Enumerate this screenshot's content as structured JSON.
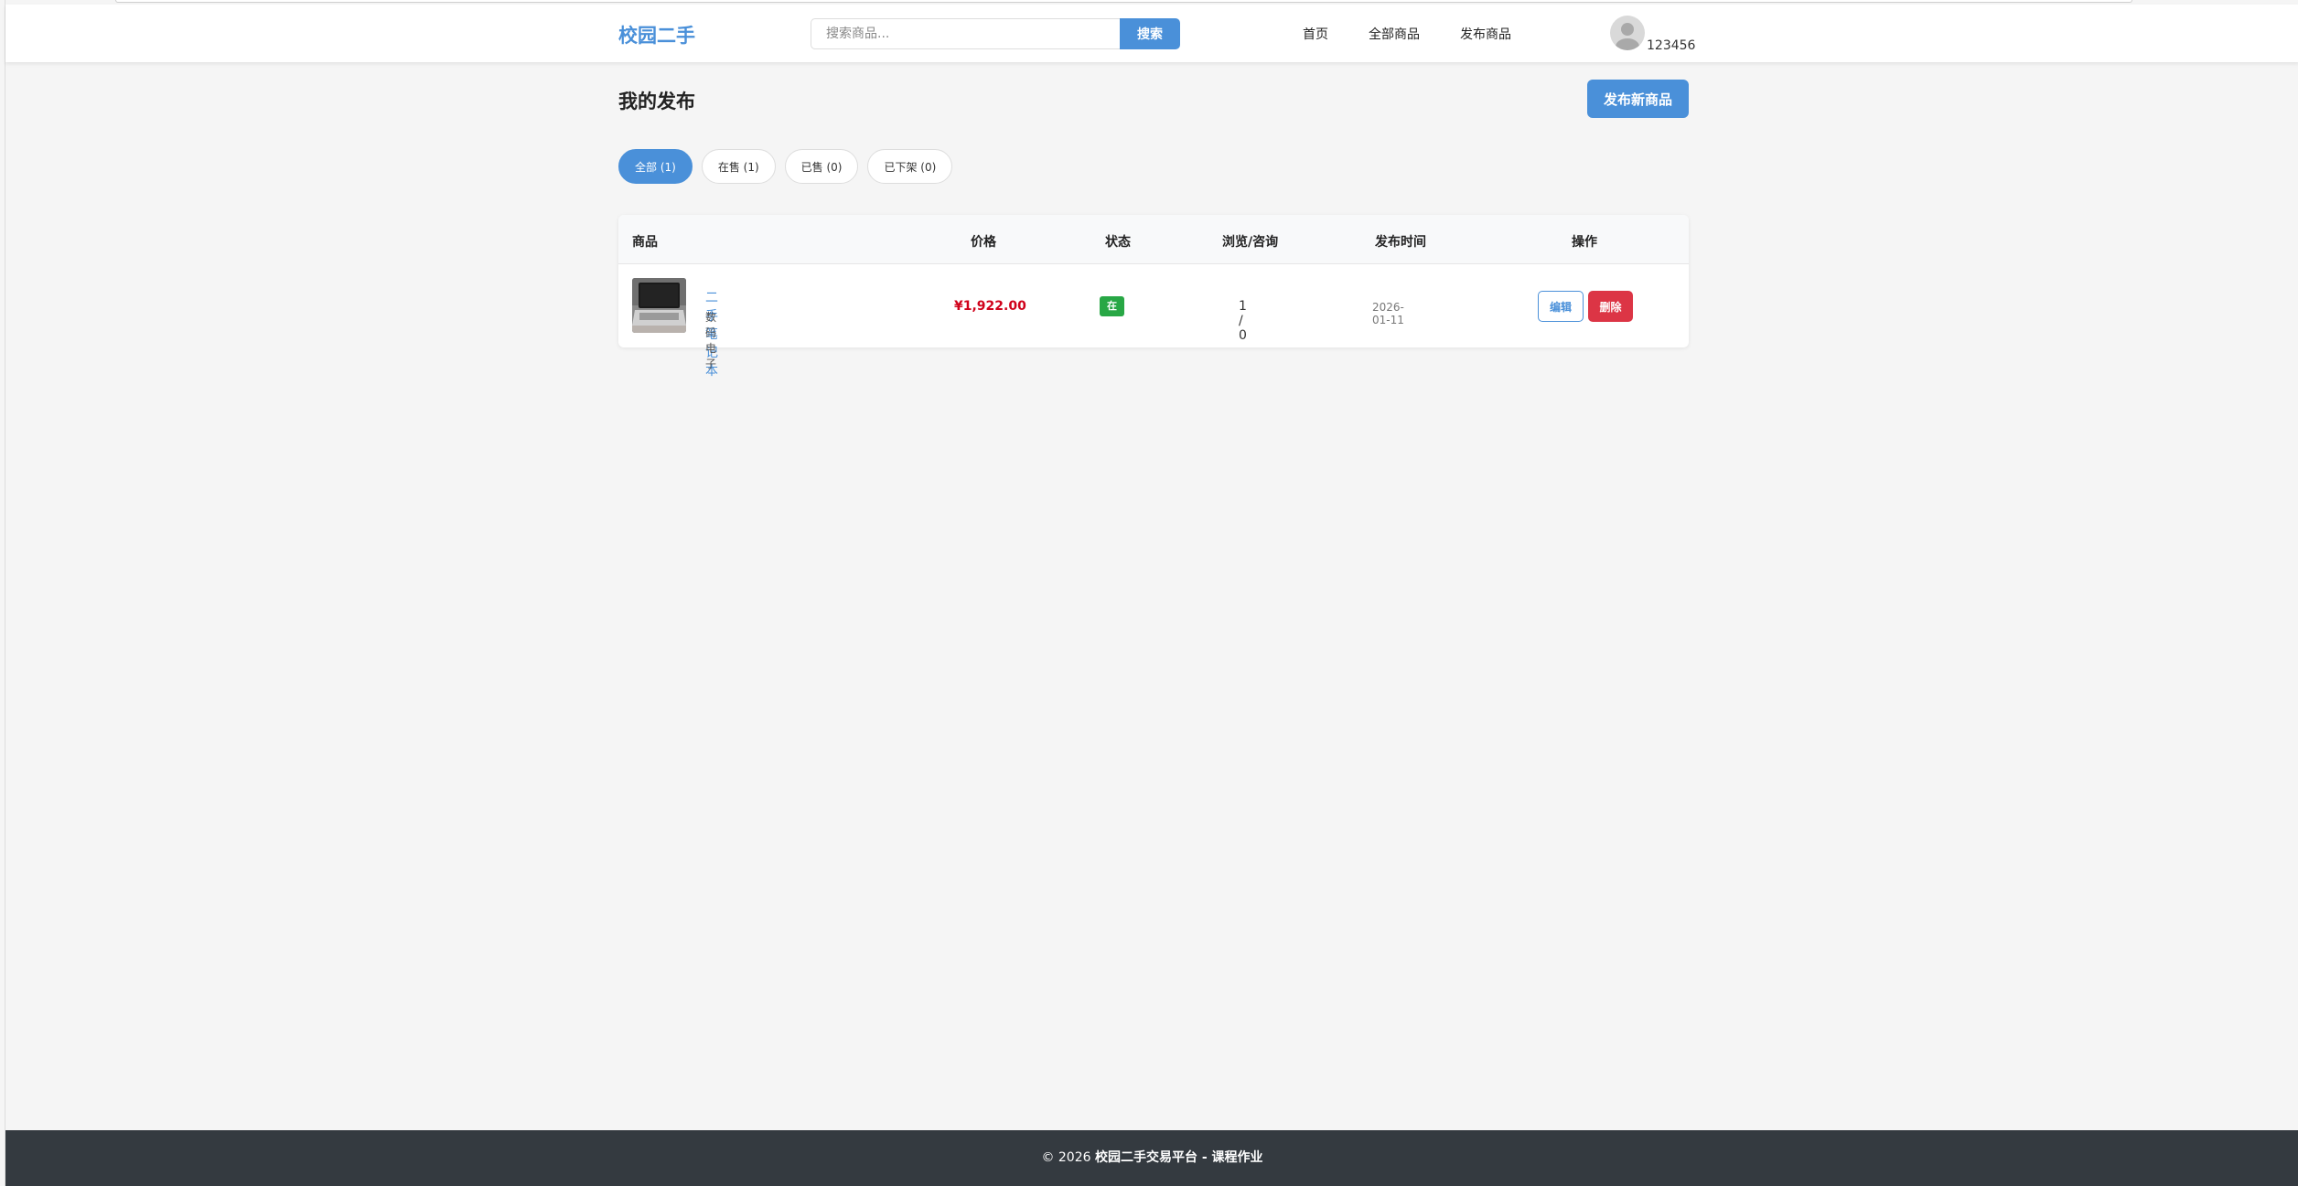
{
  "header": {
    "logo": "校园二手",
    "search_placeholder": "搜索商品...",
    "search_button": "搜索",
    "nav": {
      "home": "首页",
      "all": "全部商品",
      "publish": "发布商品"
    },
    "username": "123456"
  },
  "main": {
    "title": "我的发布",
    "new_button": "发布新商品",
    "tabs": [
      {
        "label": "全部 (1)",
        "active": true
      },
      {
        "label": "在售 (1)",
        "active": false
      },
      {
        "label": "已售 (0)",
        "active": false
      },
      {
        "label": "已下架 (0)",
        "active": false
      }
    ],
    "table": {
      "headers": {
        "product": "商品",
        "price": "价格",
        "status": "状态",
        "views": "浏览/咨询",
        "date": "发布时间",
        "actions": "操作"
      },
      "rows": [
        {
          "name": "二手笔记本",
          "category": "数码电子",
          "price": "¥1,922.00",
          "status": "在售",
          "views": "1 / 0",
          "date": "2026-01-11",
          "edit": "编辑",
          "delete": "删除"
        }
      ]
    }
  },
  "footer": {
    "copyright": "© 2026 ",
    "platform": "校园二手交易平台 - 课程作业"
  },
  "colors": {
    "primary": "#4a90d9",
    "price": "#d0021b",
    "on_sale": "#28a745",
    "danger": "#dc3545",
    "footer": "#343a40"
  }
}
